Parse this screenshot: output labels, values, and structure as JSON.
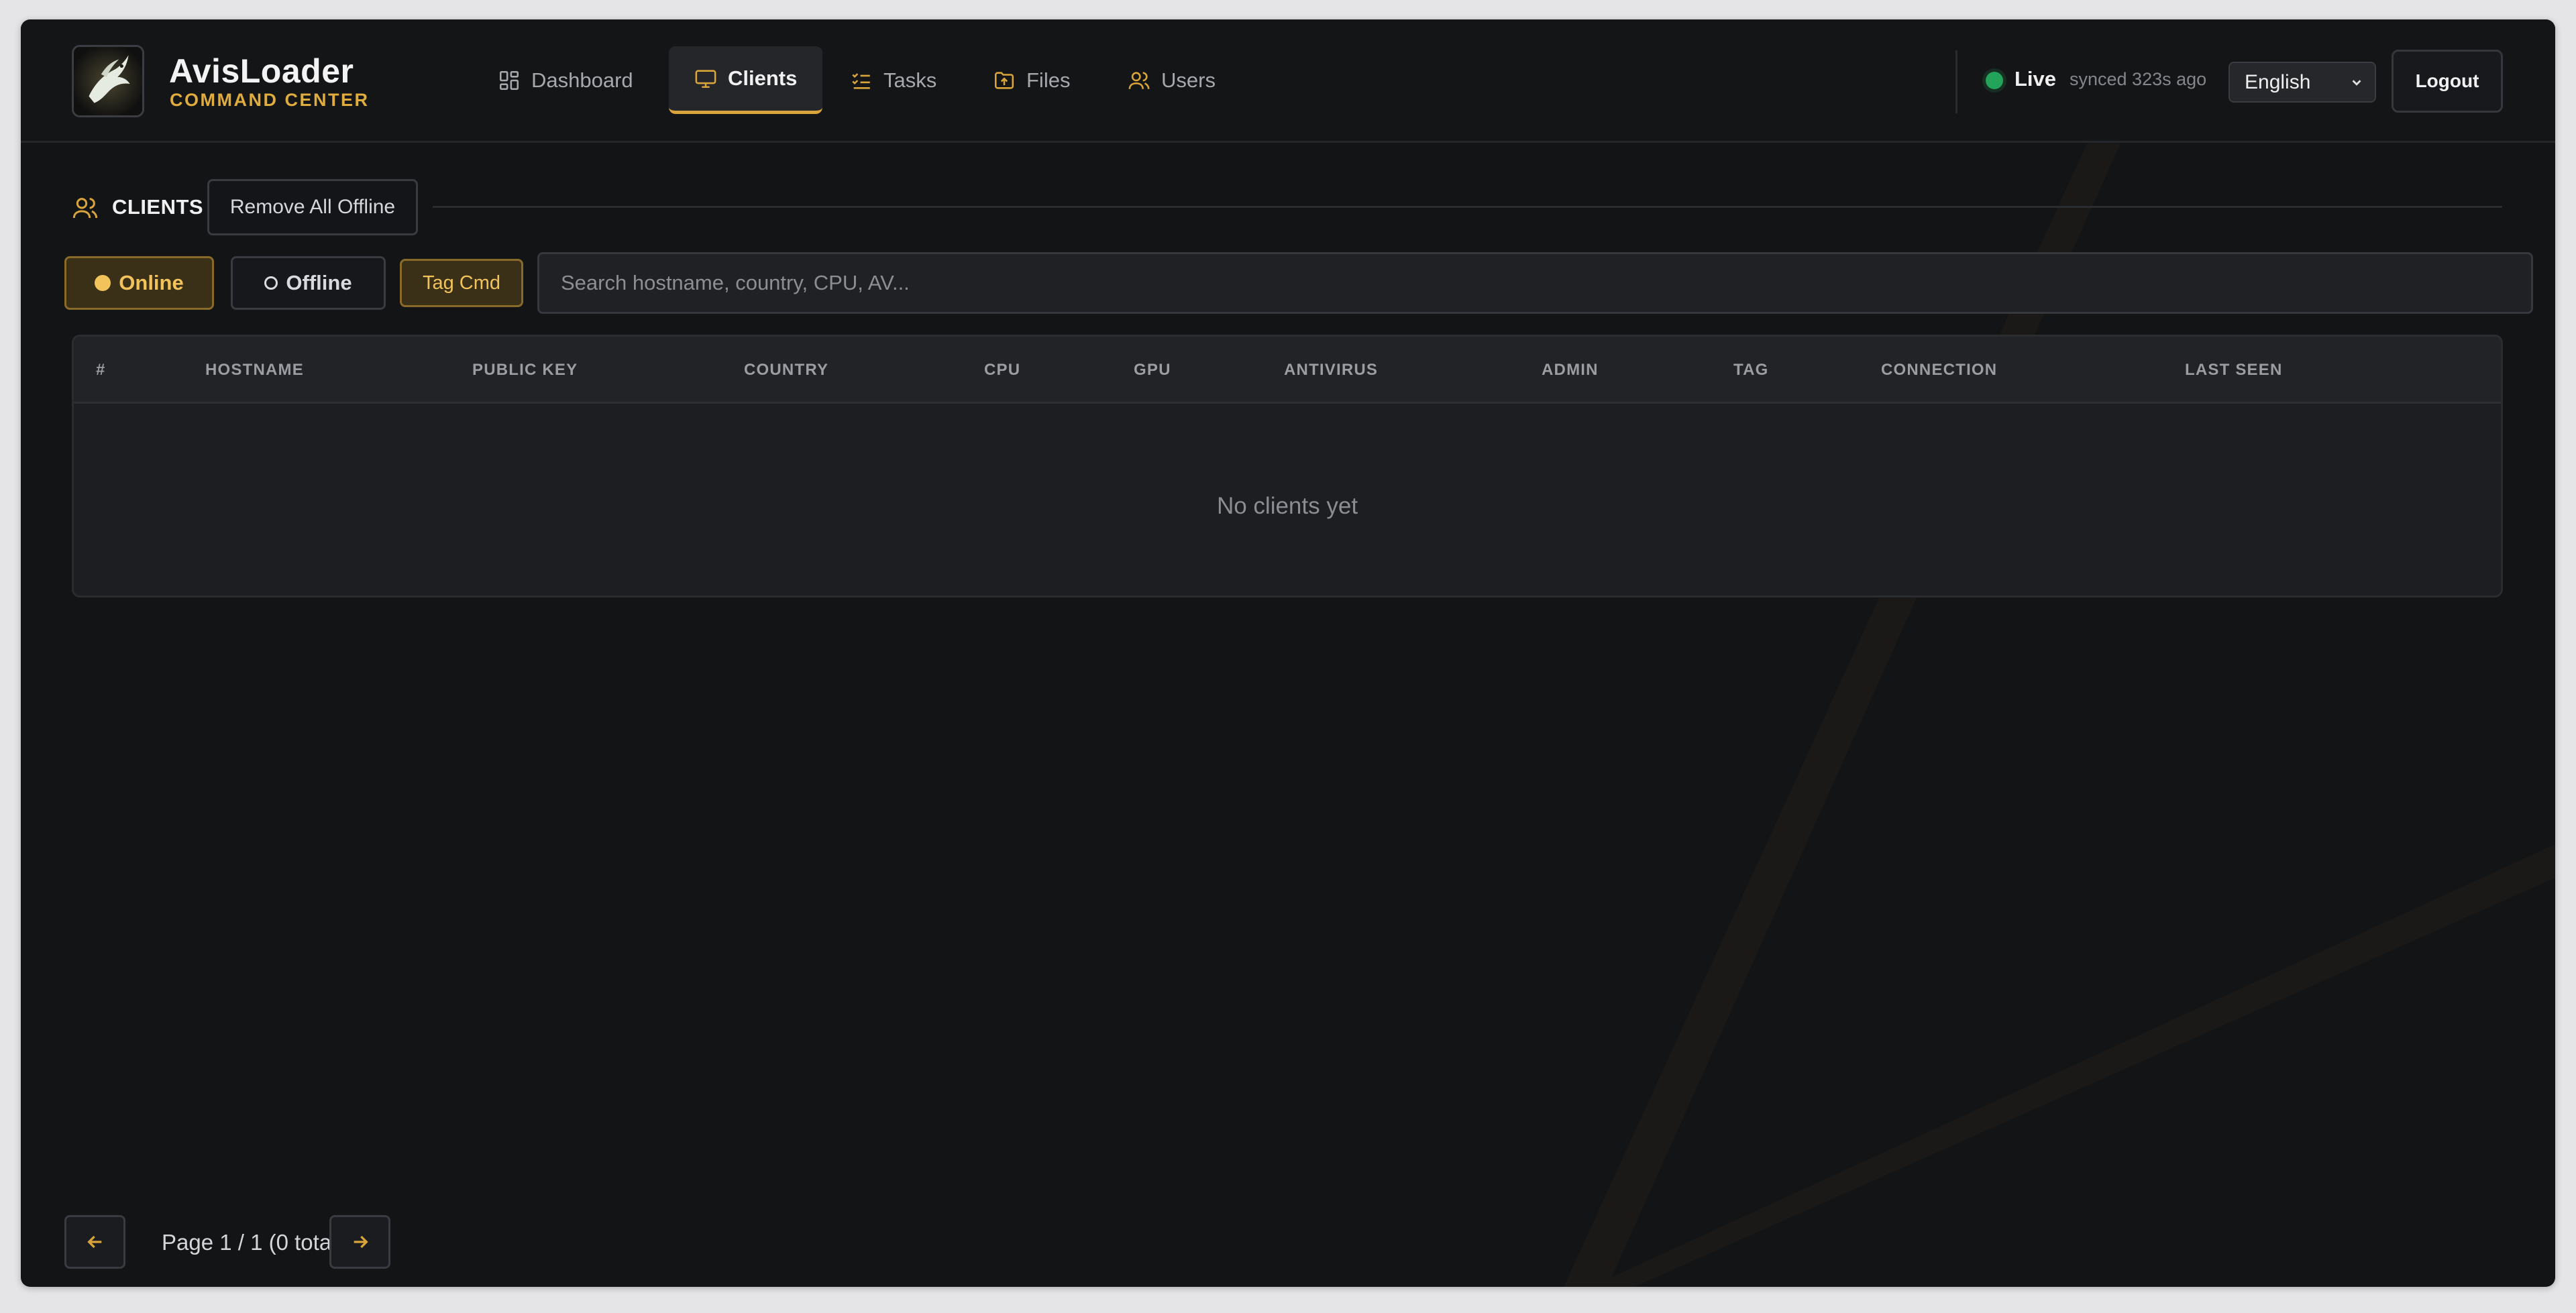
{
  "brand": {
    "name": "AvisLoader",
    "subtitle": "COMMAND CENTER"
  },
  "nav": {
    "items": [
      {
        "label": "Dashboard",
        "icon": "grid-icon",
        "active": false
      },
      {
        "label": "Clients",
        "icon": "monitor-icon",
        "active": true
      },
      {
        "label": "Tasks",
        "icon": "checklist-icon",
        "active": false
      },
      {
        "label": "Files",
        "icon": "folder-upload-icon",
        "active": false
      },
      {
        "label": "Users",
        "icon": "users-icon",
        "active": false
      }
    ]
  },
  "status": {
    "label": "Live",
    "synced": "synced 323s ago"
  },
  "language": {
    "selected": "English"
  },
  "logout_label": "Logout",
  "section": {
    "title": "CLIENTS",
    "remove_offline_label": "Remove All Offline"
  },
  "filters": {
    "online_label": "Online",
    "offline_label": "Offline",
    "tag_cmd_label": "Tag Cmd",
    "search_placeholder": "Search hostname, country, CPU, AV..."
  },
  "table": {
    "columns": [
      "#",
      "HOSTNAME",
      "PUBLIC KEY",
      "COUNTRY",
      "CPU",
      "GPU",
      "ANTIVIRUS",
      "ADMIN",
      "TAG",
      "CONNECTION",
      "LAST SEEN"
    ],
    "rows": [],
    "empty_message": "No clients yet"
  },
  "pagination": {
    "text": "Page 1 / 1 (0 total)"
  },
  "colors": {
    "accent": "#d9a53a",
    "background": "#131416",
    "live": "#23a45a"
  }
}
